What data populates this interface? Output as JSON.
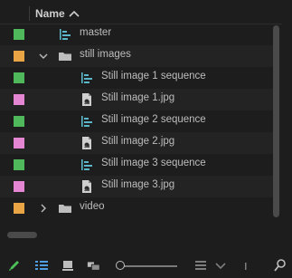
{
  "header": {
    "name_label": "Name",
    "sort": "ascending"
  },
  "colors": {
    "green": "#4fb85a",
    "orange": "#e9a446",
    "pink": "#e586d3",
    "icon_seq": "#5bb7c9",
    "folder": "#bdbdbd",
    "accent_blue": "#4d9de0",
    "pen_green": "#4fbf5a"
  },
  "items": [
    {
      "label": "master",
      "type": "sequence",
      "label_color": "green",
      "depth": 0,
      "twisty": "none"
    },
    {
      "label": "still images",
      "type": "folder",
      "label_color": "orange",
      "depth": 0,
      "twisty": "expanded"
    },
    {
      "label": "Still image 1 sequence",
      "type": "sequence",
      "label_color": "green",
      "depth": 1,
      "twisty": "none"
    },
    {
      "label": "Still image 1.jpg",
      "type": "image",
      "label_color": "pink",
      "depth": 1,
      "twisty": "none"
    },
    {
      "label": "Still image 2 sequence",
      "type": "sequence",
      "label_color": "green",
      "depth": 1,
      "twisty": "none"
    },
    {
      "label": "Still image 2.jpg",
      "type": "image",
      "label_color": "pink",
      "depth": 1,
      "twisty": "none"
    },
    {
      "label": "Still image 3 sequence",
      "type": "sequence",
      "label_color": "green",
      "depth": 1,
      "twisty": "none"
    },
    {
      "label": "Still image 3.jpg",
      "type": "image",
      "label_color": "pink",
      "depth": 1,
      "twisty": "none"
    },
    {
      "label": "video",
      "type": "folder",
      "label_color": "orange",
      "depth": 0,
      "twisty": "collapsed"
    }
  ],
  "toolbar": {
    "buttons": [
      "pencil-icon",
      "list-view-icon",
      "icon-view-icon",
      "freeform-view-icon",
      "zoom-slider",
      "sort-icon",
      "chevron-down-icon",
      "search-icon"
    ]
  }
}
